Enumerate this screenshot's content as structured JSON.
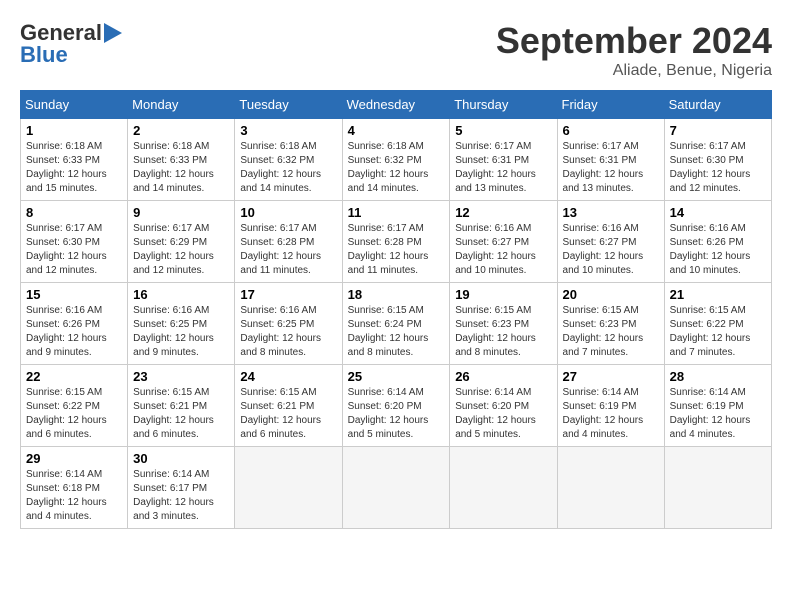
{
  "header": {
    "logo_general": "General",
    "logo_blue": "Blue",
    "month": "September 2024",
    "location": "Aliade, Benue, Nigeria"
  },
  "weekdays": [
    "Sunday",
    "Monday",
    "Tuesday",
    "Wednesday",
    "Thursday",
    "Friday",
    "Saturday"
  ],
  "weeks": [
    [
      {
        "day": 1,
        "sunrise": "6:18 AM",
        "sunset": "6:33 PM",
        "daylight": "12 hours and 15 minutes."
      },
      {
        "day": 2,
        "sunrise": "6:18 AM",
        "sunset": "6:33 PM",
        "daylight": "12 hours and 14 minutes."
      },
      {
        "day": 3,
        "sunrise": "6:18 AM",
        "sunset": "6:32 PM",
        "daylight": "12 hours and 14 minutes."
      },
      {
        "day": 4,
        "sunrise": "6:18 AM",
        "sunset": "6:32 PM",
        "daylight": "12 hours and 14 minutes."
      },
      {
        "day": 5,
        "sunrise": "6:17 AM",
        "sunset": "6:31 PM",
        "daylight": "12 hours and 13 minutes."
      },
      {
        "day": 6,
        "sunrise": "6:17 AM",
        "sunset": "6:31 PM",
        "daylight": "12 hours and 13 minutes."
      },
      {
        "day": 7,
        "sunrise": "6:17 AM",
        "sunset": "6:30 PM",
        "daylight": "12 hours and 12 minutes."
      }
    ],
    [
      {
        "day": 8,
        "sunrise": "6:17 AM",
        "sunset": "6:30 PM",
        "daylight": "12 hours and 12 minutes."
      },
      {
        "day": 9,
        "sunrise": "6:17 AM",
        "sunset": "6:29 PM",
        "daylight": "12 hours and 12 minutes."
      },
      {
        "day": 10,
        "sunrise": "6:17 AM",
        "sunset": "6:28 PM",
        "daylight": "12 hours and 11 minutes."
      },
      {
        "day": 11,
        "sunrise": "6:17 AM",
        "sunset": "6:28 PM",
        "daylight": "12 hours and 11 minutes."
      },
      {
        "day": 12,
        "sunrise": "6:16 AM",
        "sunset": "6:27 PM",
        "daylight": "12 hours and 10 minutes."
      },
      {
        "day": 13,
        "sunrise": "6:16 AM",
        "sunset": "6:27 PM",
        "daylight": "12 hours and 10 minutes."
      },
      {
        "day": 14,
        "sunrise": "6:16 AM",
        "sunset": "6:26 PM",
        "daylight": "12 hours and 10 minutes."
      }
    ],
    [
      {
        "day": 15,
        "sunrise": "6:16 AM",
        "sunset": "6:26 PM",
        "daylight": "12 hours and 9 minutes."
      },
      {
        "day": 16,
        "sunrise": "6:16 AM",
        "sunset": "6:25 PM",
        "daylight": "12 hours and 9 minutes."
      },
      {
        "day": 17,
        "sunrise": "6:16 AM",
        "sunset": "6:25 PM",
        "daylight": "12 hours and 8 minutes."
      },
      {
        "day": 18,
        "sunrise": "6:15 AM",
        "sunset": "6:24 PM",
        "daylight": "12 hours and 8 minutes."
      },
      {
        "day": 19,
        "sunrise": "6:15 AM",
        "sunset": "6:23 PM",
        "daylight": "12 hours and 8 minutes."
      },
      {
        "day": 20,
        "sunrise": "6:15 AM",
        "sunset": "6:23 PM",
        "daylight": "12 hours and 7 minutes."
      },
      {
        "day": 21,
        "sunrise": "6:15 AM",
        "sunset": "6:22 PM",
        "daylight": "12 hours and 7 minutes."
      }
    ],
    [
      {
        "day": 22,
        "sunrise": "6:15 AM",
        "sunset": "6:22 PM",
        "daylight": "12 hours and 6 minutes."
      },
      {
        "day": 23,
        "sunrise": "6:15 AM",
        "sunset": "6:21 PM",
        "daylight": "12 hours and 6 minutes."
      },
      {
        "day": 24,
        "sunrise": "6:15 AM",
        "sunset": "6:21 PM",
        "daylight": "12 hours and 6 minutes."
      },
      {
        "day": 25,
        "sunrise": "6:14 AM",
        "sunset": "6:20 PM",
        "daylight": "12 hours and 5 minutes."
      },
      {
        "day": 26,
        "sunrise": "6:14 AM",
        "sunset": "6:20 PM",
        "daylight": "12 hours and 5 minutes."
      },
      {
        "day": 27,
        "sunrise": "6:14 AM",
        "sunset": "6:19 PM",
        "daylight": "12 hours and 4 minutes."
      },
      {
        "day": 28,
        "sunrise": "6:14 AM",
        "sunset": "6:19 PM",
        "daylight": "12 hours and 4 minutes."
      }
    ],
    [
      {
        "day": 29,
        "sunrise": "6:14 AM",
        "sunset": "6:18 PM",
        "daylight": "12 hours and 4 minutes."
      },
      {
        "day": 30,
        "sunrise": "6:14 AM",
        "sunset": "6:17 PM",
        "daylight": "12 hours and 3 minutes."
      },
      null,
      null,
      null,
      null,
      null
    ]
  ]
}
